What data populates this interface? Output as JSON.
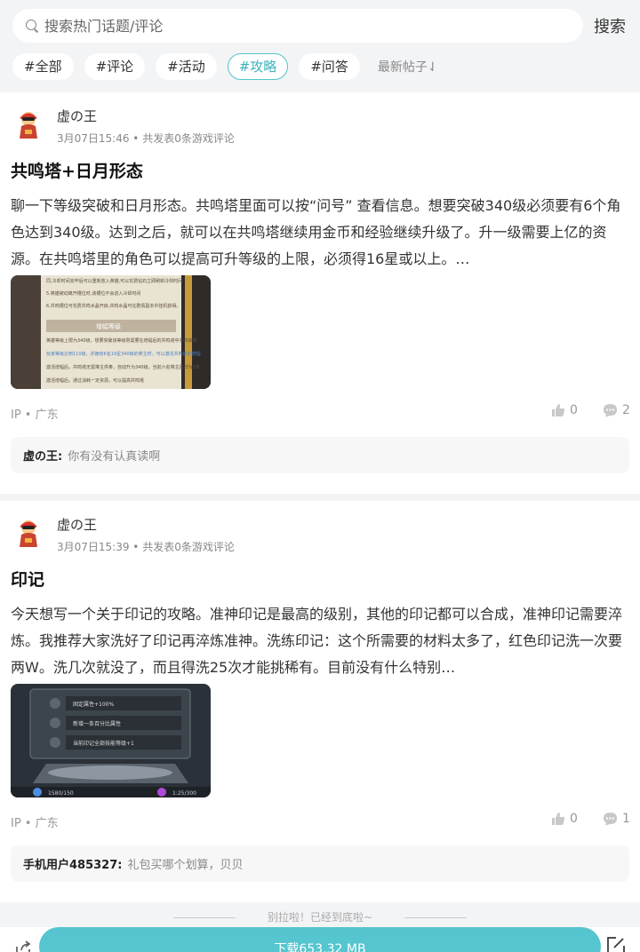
{
  "search": {
    "placeholder": "搜索热门话题/评论",
    "button": "搜索"
  },
  "tags": [
    {
      "label": "#全部",
      "active": false
    },
    {
      "label": "#评论",
      "active": false
    },
    {
      "label": "#活动",
      "active": false
    },
    {
      "label": "#攻略",
      "active": true
    },
    {
      "label": "#问答",
      "active": false
    }
  ],
  "sort_label": "最新帖子⇃",
  "posts": [
    {
      "author": "虚の王",
      "meta": "3月07日15:46 • 共发表0条游戏评论",
      "title": "共鸣塔+日月形态",
      "excerpt": "聊一下等级突破和日月形态。共鸣塔里面可以按“问号” 查看信息。想要突破340级必须要有6个角色达到340级。达到之后，就可以在共鸣塔继续用金币和经验继续升级了。升一级需要上亿的资源。在共鸣塔里的角色可以提高可升等级的上限，必须得16星或以上。…",
      "thumb_lines": [
        "同,冷却时间完毕后可以重新放入英雄,可以花费钻石立即刷新冷却时间",
        "5.英雄被动离开槽位时,该槽位不会进入冷却时间",
        "6.共鸣槽位可花费共鸣水晶开启,共鸣水晶可在剧情副本中挂机获得。",
        "增幅等级",
        "英雄等级上限为340级，想要突破该等级则需要在增幅后的共鸣塔中共鸣获得",
        "玩家等级达到110级，并拥有6名19星340级的英主时，可以激活共鸣塔的增幅",
        "激活增幅后，共鸣塔无需堆主供奉，自动升为340级，当前六名堆主回归为1级",
        "激活增幅后，通过消耗一定资源，可以提高共鸣塔"
      ],
      "ip": "IP • 广东",
      "likes": "0",
      "comments": "2",
      "reply_user": "虚の王:",
      "reply_text": "你有没有认真读啊"
    },
    {
      "author": "虚の王",
      "meta": "3月07日15:39 • 共发表0条游戏评论",
      "title": "印记",
      "excerpt": "今天想写一个关于印记的攻略。准神印记是最高的级别，其他的印记都可以合成，准神印记需要淬炼。我推荐大家洗好了印记再淬炼准神。洗练印记：这个所需要的材料太多了，红色印记洗一次要两W。洗几次就没了，而且得洗25次才能挑稀有。目前没有什么特别…",
      "thumb_lines": [
        "固定属性+100%",
        "新增一条百分比属性",
        "当前印记全部技能等级+1",
        "1580/150",
        "1:25/300"
      ],
      "ip": "IP • 广东",
      "likes": "0",
      "comments": "1",
      "reply_user": "手机用户485327:",
      "reply_text": "礼包买哪个划算，贝贝"
    }
  ],
  "end_text": "别拉啦！已经到底啦~",
  "download_label": "下载653.32 MB",
  "colors": {
    "accent": "#55c5cf",
    "background": "#f3f4f6"
  }
}
